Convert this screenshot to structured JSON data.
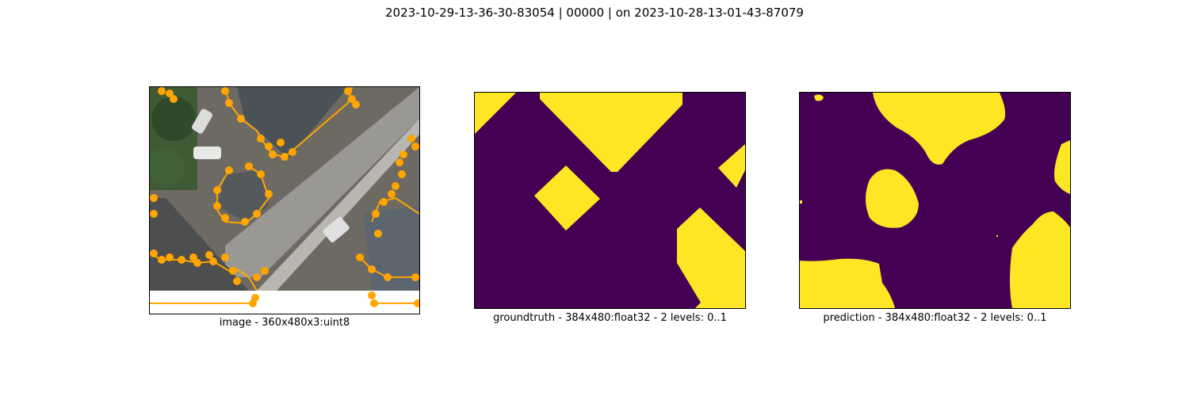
{
  "figure": {
    "suptitle": "2023-10-29-13-36-30-83054 | 00000 | on 2023-10-28-13-01-43-87079"
  },
  "panels": [
    {
      "caption": "image - 360x480x3:uint8"
    },
    {
      "caption": "groundtruth - 384x480:float32 - 2 levels: 0..1"
    },
    {
      "caption": "prediction - 384x480:float32 - 2 levels: 0..1"
    }
  ],
  "colors": {
    "mask_background": "#440154",
    "mask_foreground": "#fde725",
    "overlay": "#ffa500"
  },
  "icons": [
    "aerial-photo",
    "segmentation-mask"
  ]
}
